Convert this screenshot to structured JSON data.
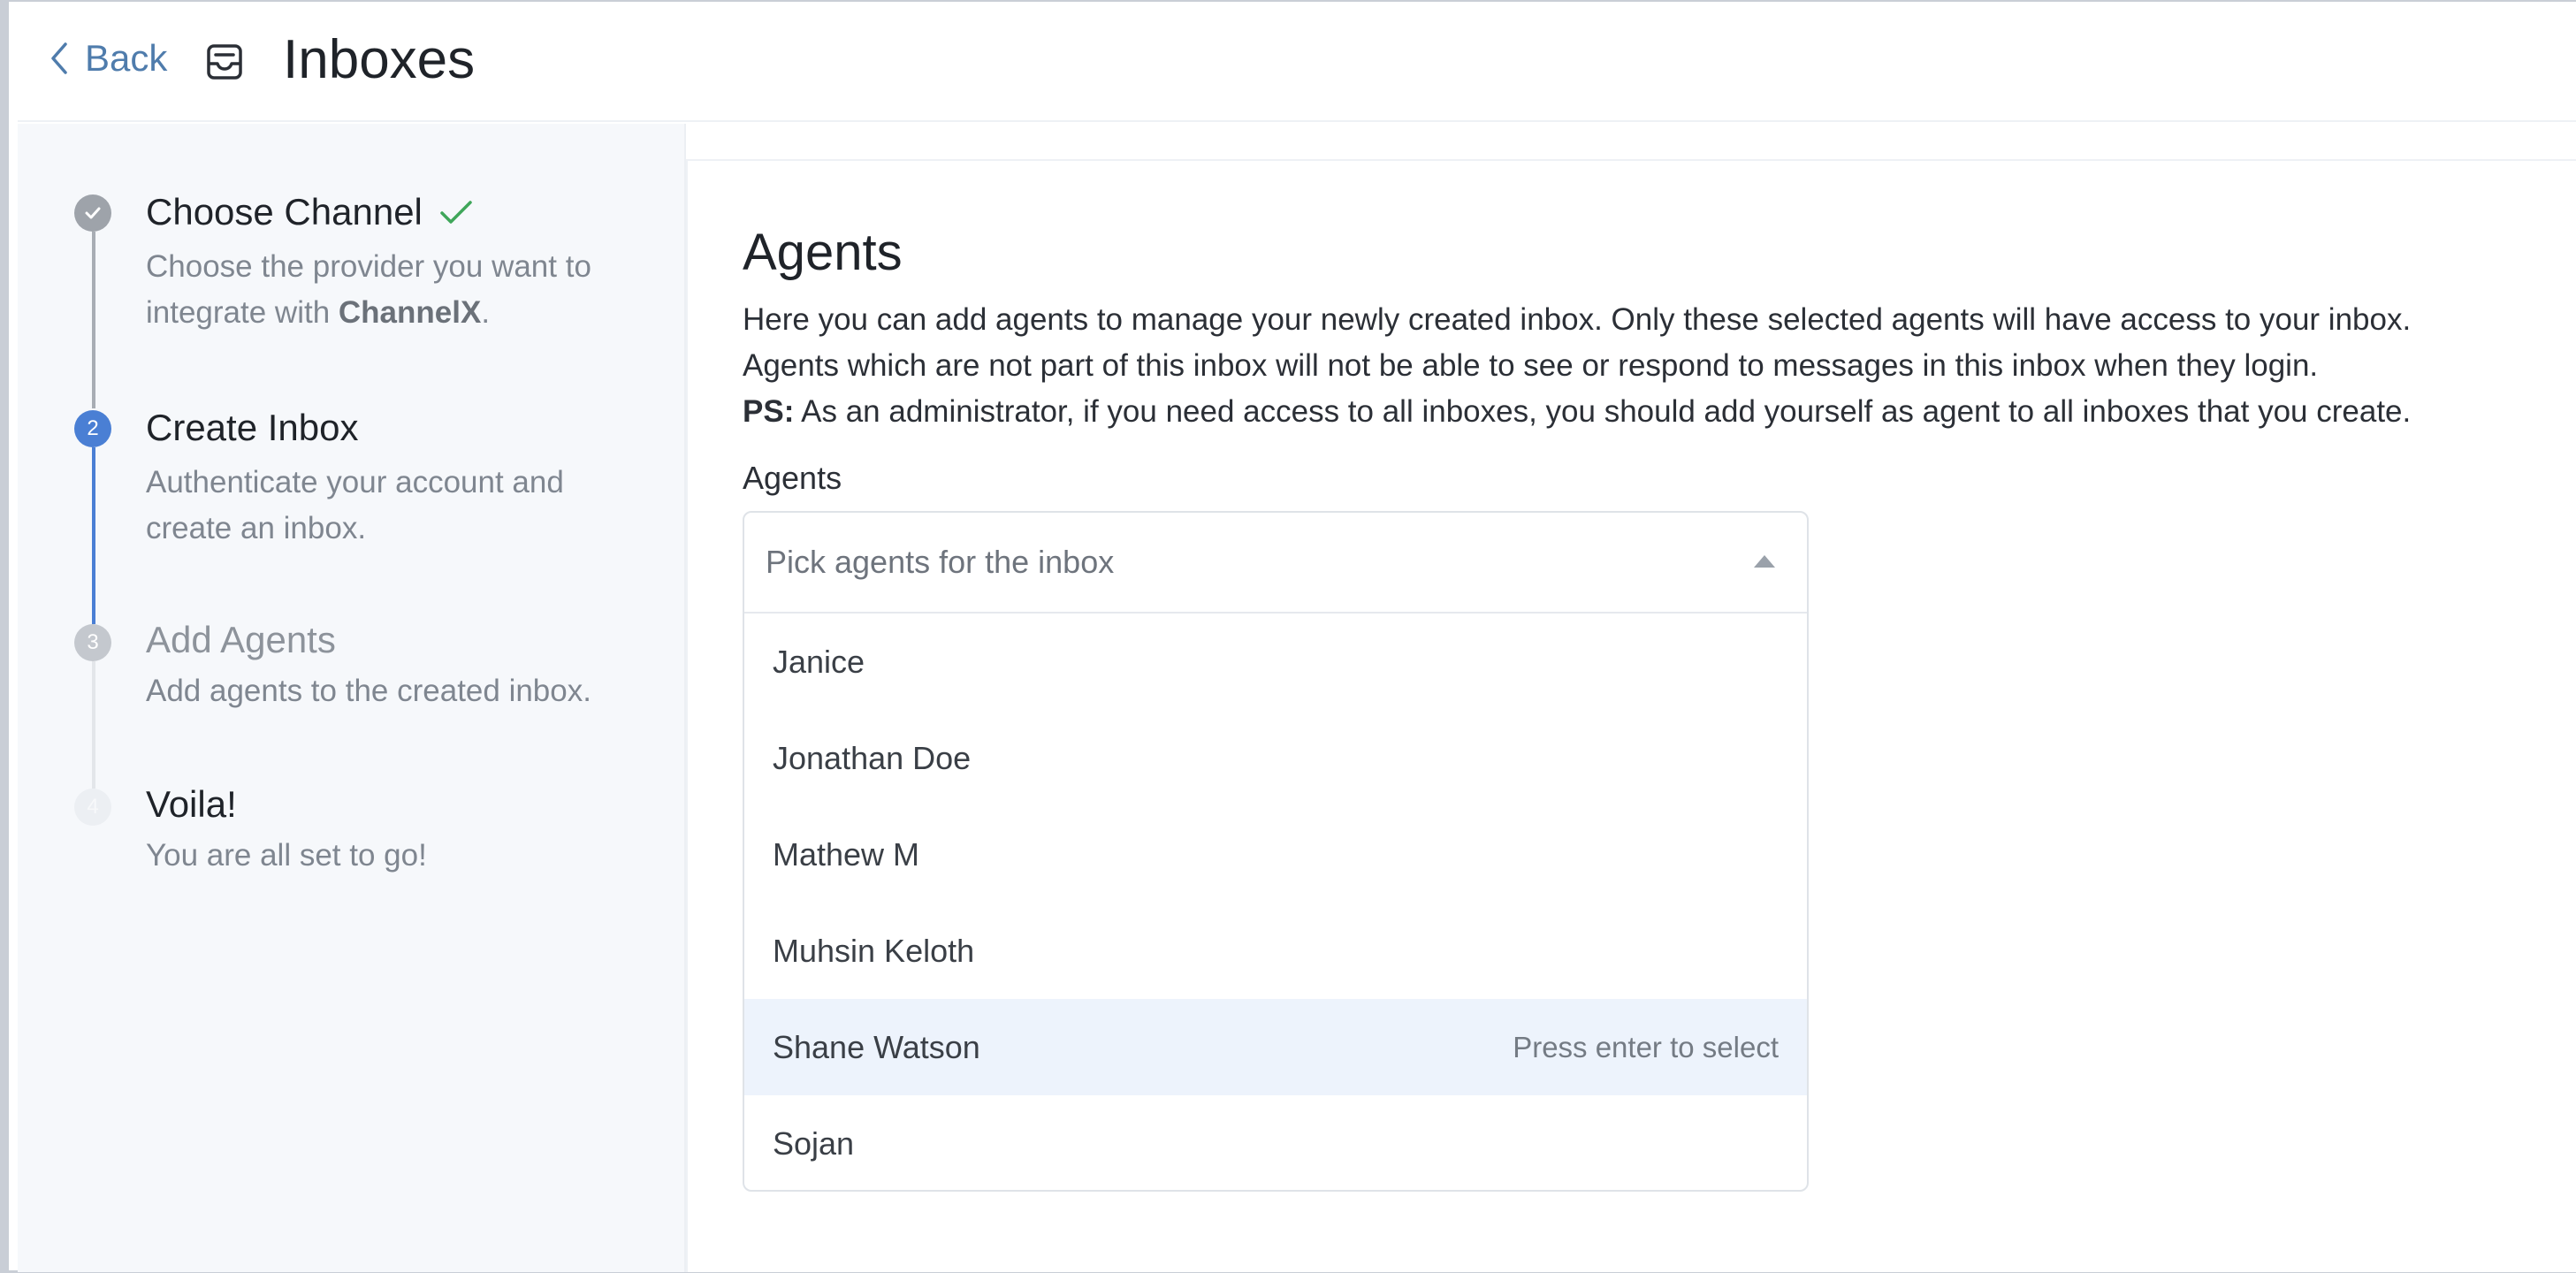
{
  "header": {
    "back_label": "Back",
    "title": "Inboxes",
    "back_icon": "chevron-left-icon",
    "inbox_icon": "inbox-icon"
  },
  "steps": [
    {
      "number": "",
      "title": "Choose Channel",
      "desc_before": "Choose the provider you want to integrate with ",
      "desc_bold": "ChannelX",
      "desc_after": ".",
      "state": "completed"
    },
    {
      "number": "2",
      "title": "Create Inbox",
      "desc": "Authenticate your account and create an inbox.",
      "state": "active"
    },
    {
      "number": "3",
      "title": "Add Agents",
      "desc": "Add agents to the created inbox.",
      "state": "upcoming"
    },
    {
      "number": "4",
      "title": "Voila!",
      "desc": "You are all set to go!",
      "state": "upcoming"
    }
  ],
  "main": {
    "title": "Agents",
    "desc_line1": "Here you can add agents to manage your newly created inbox. Only these selected agents will have access to your inbox.",
    "desc_line2": "Agents which are not part of this inbox will not be able to see or respond to messages in this inbox when they login.",
    "ps_label": "PS:",
    "ps_text": " As an administrator, if you need access to all inboxes, you should add yourself as agent to all inboxes that you create.",
    "field_label": "Agents",
    "select_placeholder": "Pick agents for the inbox",
    "options": [
      "Janice",
      "Jonathan Doe",
      "Mathew M",
      "Muhsin Keloth",
      "Shane Watson",
      "Sojan"
    ],
    "highlighted_option": "Shane Watson",
    "select_hint": "Press enter to select"
  },
  "colors": {
    "accent": "#4a7fd4",
    "completed_dot": "#9ea3aa",
    "check": "#3fa65a",
    "back_link": "#4f7cac",
    "highlight_row": "#edf3fc"
  }
}
